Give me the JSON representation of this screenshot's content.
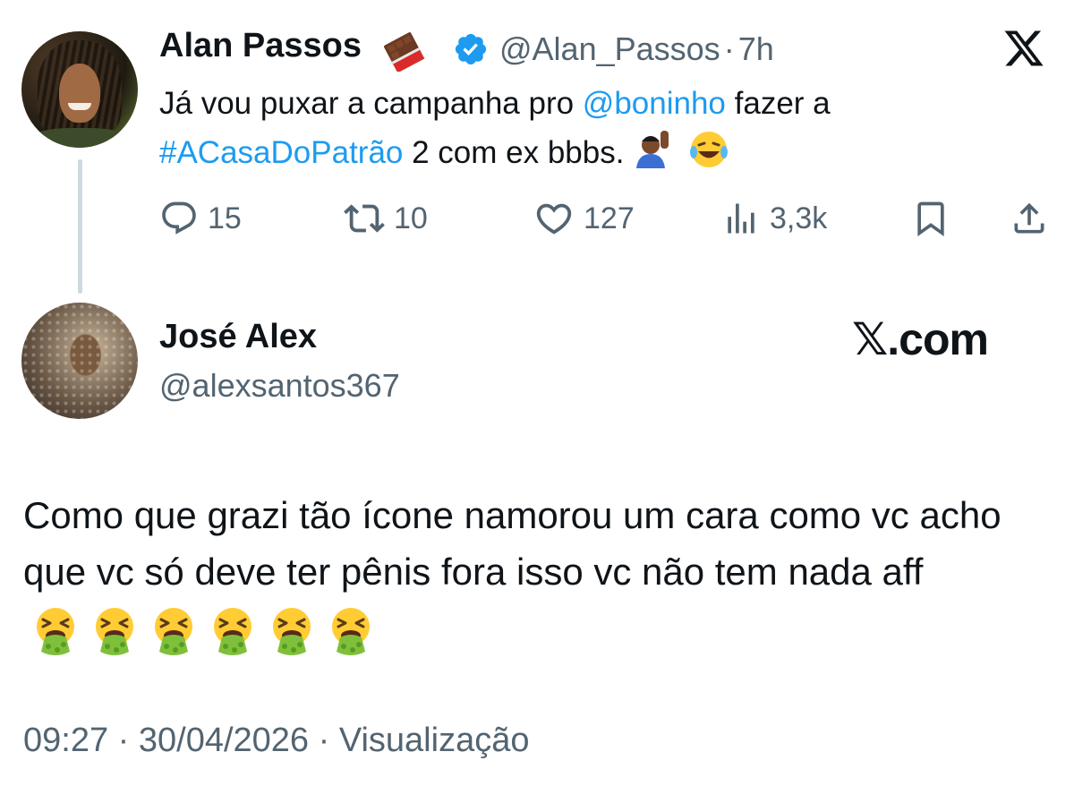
{
  "parent_tweet": {
    "author_name": "Alan Passos",
    "author_handle": "@Alan_Passos",
    "separator": "·",
    "time_ago": "7h",
    "name_emoji": "chocolate-bar-icon",
    "verified": true,
    "text_before_mention": "Já vou puxar a campanha pro ",
    "mention": "@boninho",
    "text_after_mention": " fazer a",
    "hashtag": "#ACasaDoPatrão",
    "text_after_hashtag": " 2 com ex bbbs. ",
    "trailing_emojis": [
      "person-raising-hand-icon",
      "laughing-tears-icon"
    ],
    "actions": {
      "replies": "15",
      "retweets": "10",
      "likes": "127",
      "views": "3,3k"
    }
  },
  "reply_tweet": {
    "author_name": "José Alex",
    "author_handle": "@alexsantos367",
    "platform_label": "𝕏.com",
    "text": "Como que grazi tão  ícone  namorou um cara como vc acho que  vc só  deve ter pênis  fora isso  vc não tem nada aff",
    "emoji_count": 6,
    "emoji": "vomiting-face-icon",
    "timestamp": "09:27 · 30/04/2026 · Visualização"
  },
  "colors": {
    "link": "#1d9bf0",
    "secondary_text": "#536471",
    "primary_text": "#0f1419",
    "thread_line": "#cfd9de"
  }
}
